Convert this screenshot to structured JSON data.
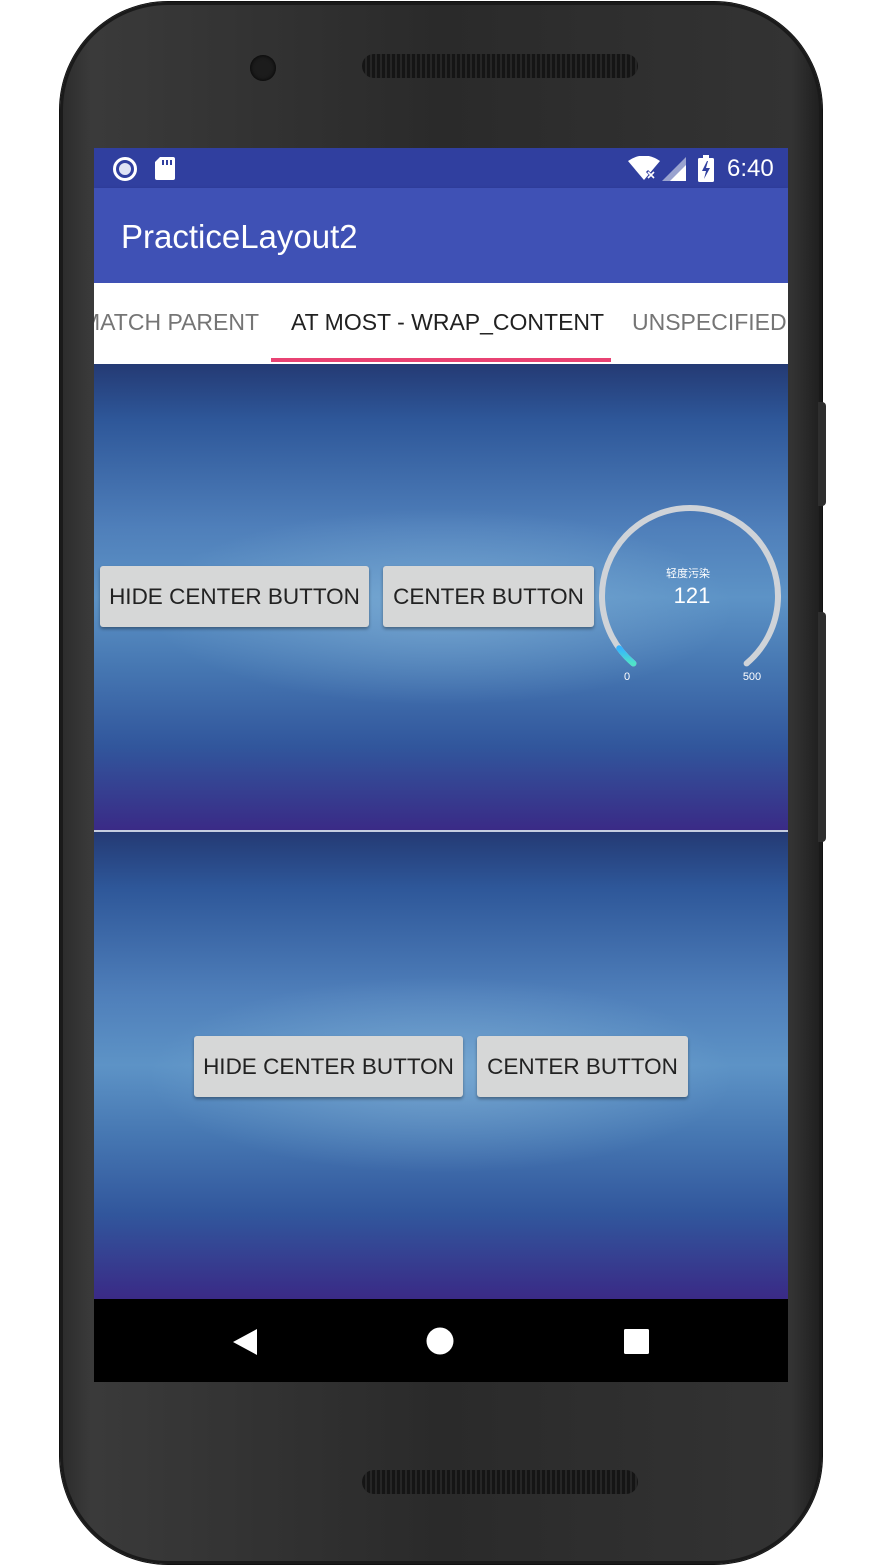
{
  "status_bar": {
    "time": "6:40"
  },
  "app_bar": {
    "title": "PracticeLayout2"
  },
  "tabs": [
    {
      "label": "MATCH PARENT",
      "selected": false
    },
    {
      "label": "AT MOST - WRAP_CONTENT",
      "selected": true
    },
    {
      "label": "UNSPECIFIED - ",
      "selected": false
    }
  ],
  "top_panel": {
    "hide_button_label": "HIDE CENTER BUTTON",
    "center_button_label": "CENTER BUTTON",
    "gauge": {
      "label": "轻度污染",
      "value": "121",
      "min_label": "0",
      "max_label": "500",
      "value_num": 121,
      "max": 500
    }
  },
  "bottom_panel": {
    "hide_button_label": "HIDE CENTER BUTTON",
    "center_button_label": "CENTER BUTTON"
  },
  "colors": {
    "status_bar": "#303F9F",
    "app_bar": "#3F51B5",
    "tab_indicator": "#E84273",
    "button": "#D6D7D7"
  },
  "nav_bar": {
    "icons": [
      "back-icon",
      "home-icon",
      "recents-icon"
    ]
  }
}
